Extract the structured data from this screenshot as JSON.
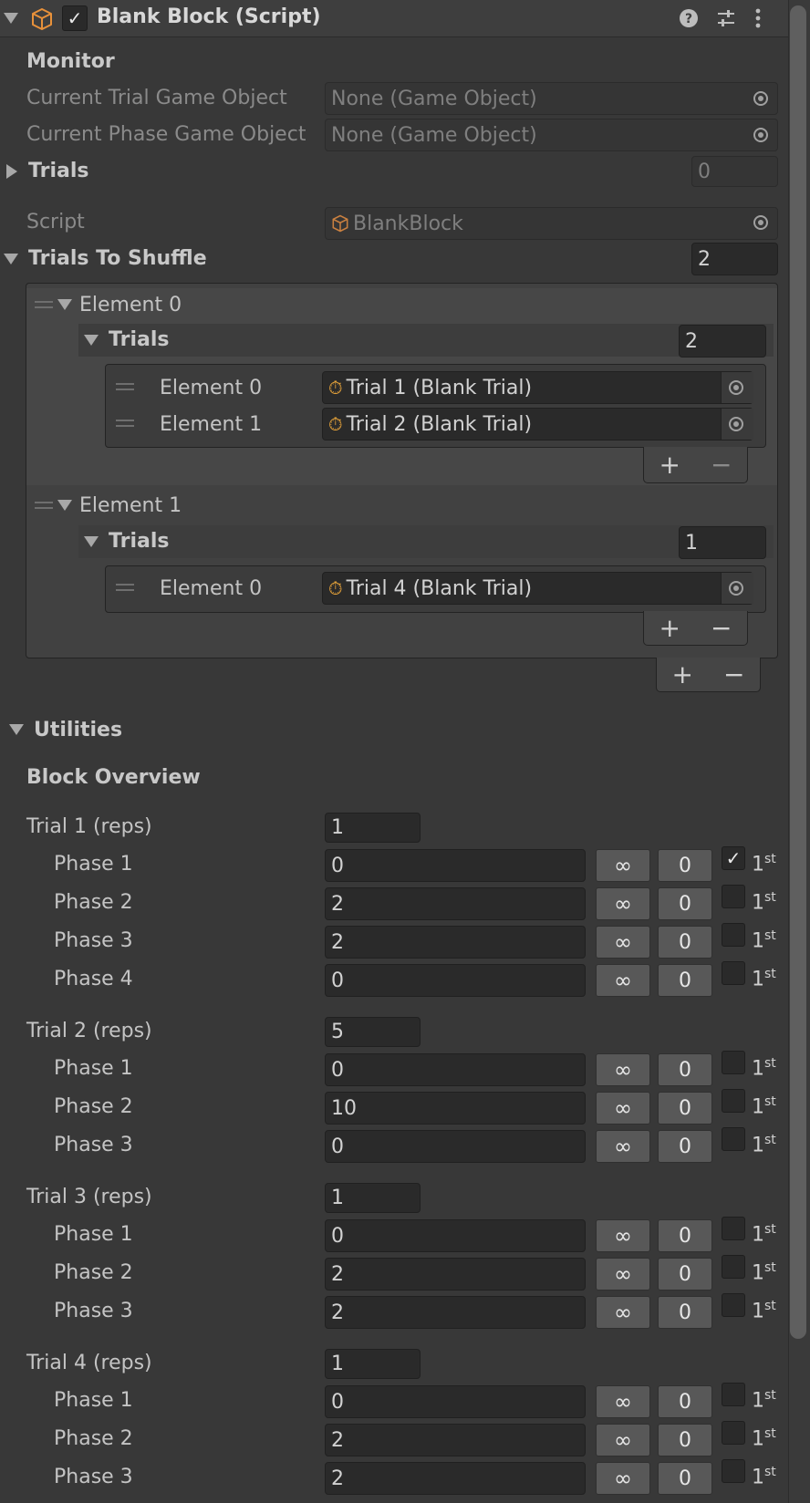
{
  "header": {
    "title": "Blank Block (Script)",
    "enabled_check": "✓"
  },
  "monitor": {
    "section": "Monitor",
    "trial_label": "Current Trial Game Object",
    "trial_value": "None (Game Object)",
    "phase_label": "Current Phase Game Object",
    "phase_value": "None (Game Object)"
  },
  "trials": {
    "label": "Trials",
    "count": "0"
  },
  "script": {
    "label": "Script",
    "value": "BlankBlock"
  },
  "shuffle": {
    "label": "Trials To Shuffle",
    "count": "2",
    "elements": [
      {
        "label": "Element 0",
        "trials_label": "Trials",
        "trials_count": "2",
        "items": [
          {
            "label": "Element 0",
            "value": "Trial 1 (Blank Trial)"
          },
          {
            "label": "Element 1",
            "value": "Trial 2 (Blank Trial)"
          }
        ]
      },
      {
        "label": "Element 1",
        "trials_label": "Trials",
        "trials_count": "1",
        "items": [
          {
            "label": "Element 0",
            "value": "Trial 4 (Blank Trial)"
          }
        ]
      }
    ]
  },
  "buttons": {
    "plus": "+",
    "minus": "−",
    "infinity": "∞"
  },
  "utilities": {
    "label": "Utilities",
    "overview": "Block Overview"
  },
  "first_label": "1",
  "first_suffix": "st",
  "overview": [
    {
      "trial": "Trial 1 (reps)",
      "reps": "1",
      "phases": [
        {
          "label": "Phase 1",
          "value": "0",
          "zero": "0",
          "checked": true
        },
        {
          "label": "Phase 2",
          "value": "2",
          "zero": "0",
          "checked": false
        },
        {
          "label": "Phase 3",
          "value": "2",
          "zero": "0",
          "checked": false
        },
        {
          "label": "Phase 4",
          "value": "0",
          "zero": "0",
          "checked": false
        }
      ]
    },
    {
      "trial": "Trial 2 (reps)",
      "reps": "5",
      "phases": [
        {
          "label": "Phase 1",
          "value": "0",
          "zero": "0",
          "checked": false
        },
        {
          "label": "Phase 2",
          "value": "10",
          "zero": "0",
          "checked": false
        },
        {
          "label": "Phase 3",
          "value": "0",
          "zero": "0",
          "checked": false
        }
      ]
    },
    {
      "trial": "Trial 3 (reps)",
      "reps": "1",
      "phases": [
        {
          "label": "Phase 1",
          "value": "0",
          "zero": "0",
          "checked": false
        },
        {
          "label": "Phase 2",
          "value": "2",
          "zero": "0",
          "checked": false
        },
        {
          "label": "Phase 3",
          "value": "2",
          "zero": "0",
          "checked": false
        }
      ]
    },
    {
      "trial": "Trial 4 (reps)",
      "reps": "1",
      "phases": [
        {
          "label": "Phase 1",
          "value": "0",
          "zero": "0",
          "checked": false
        },
        {
          "label": "Phase 2",
          "value": "2",
          "zero": "0",
          "checked": false
        },
        {
          "label": "Phase 3",
          "value": "2",
          "zero": "0",
          "checked": false
        }
      ]
    }
  ]
}
